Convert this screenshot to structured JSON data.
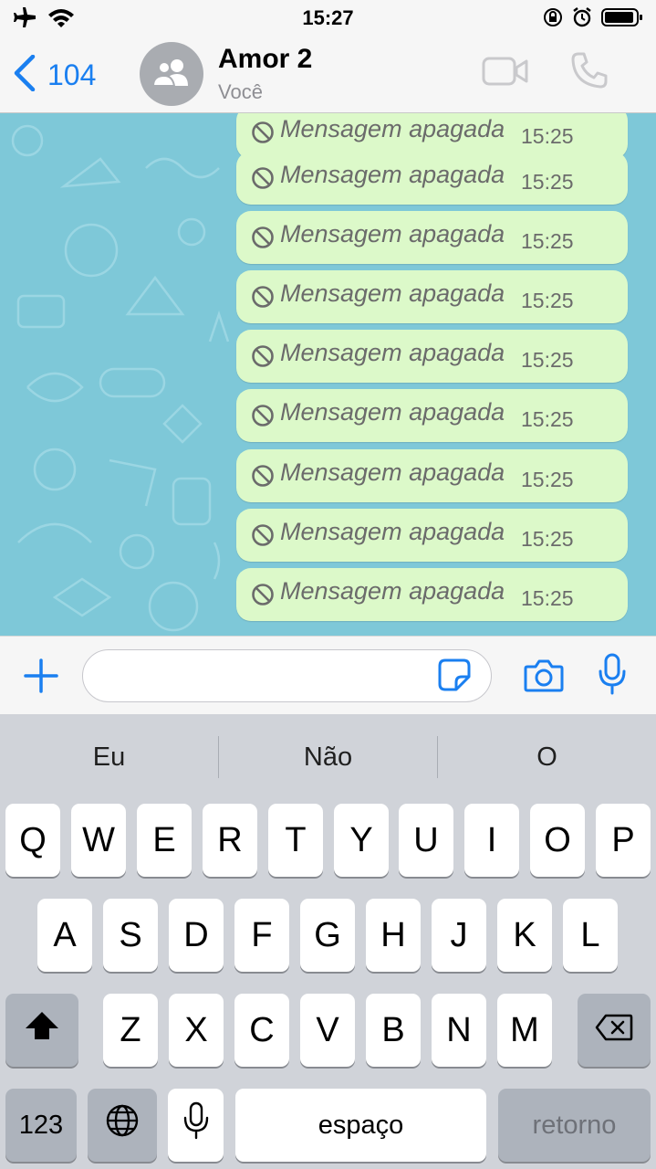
{
  "status_bar": {
    "time": "15:27",
    "left_icons": [
      "airplane-icon",
      "wifi-icon"
    ],
    "right_icons": [
      "rotation-lock-icon",
      "alarm-icon",
      "battery-icon"
    ]
  },
  "header": {
    "back_count": "104",
    "contact_name": "Amor 2",
    "contact_subtitle": "Você",
    "actions": [
      "video-call-icon",
      "phone-icon"
    ]
  },
  "messages": [
    {
      "text": "Mensagem apagada",
      "time": "15:25"
    },
    {
      "text": "Mensagem apagada",
      "time": "15:25"
    },
    {
      "text": "Mensagem apagada",
      "time": "15:25"
    },
    {
      "text": "Mensagem apagada",
      "time": "15:25"
    },
    {
      "text": "Mensagem apagada",
      "time": "15:25"
    },
    {
      "text": "Mensagem apagada",
      "time": "15:25"
    },
    {
      "text": "Mensagem apagada",
      "time": "15:25"
    },
    {
      "text": "Mensagem apagada",
      "time": "15:25"
    },
    {
      "text": "Mensagem apagada",
      "time": "15:25"
    }
  ],
  "input_bar": {
    "value": "",
    "icons": [
      "plus-icon",
      "sticker-icon",
      "camera-icon",
      "microphone-icon"
    ]
  },
  "keyboard": {
    "suggestions": [
      "Eu",
      "Não",
      "O"
    ],
    "row1": [
      "Q",
      "W",
      "E",
      "R",
      "T",
      "Y",
      "U",
      "I",
      "O",
      "P"
    ],
    "row2": [
      "A",
      "S",
      "D",
      "F",
      "G",
      "H",
      "J",
      "K",
      "L"
    ],
    "row3": [
      "Z",
      "X",
      "C",
      "V",
      "B",
      "N",
      "M"
    ],
    "numbers_label": "123",
    "space_label": "espaço",
    "return_label": "retorno"
  },
  "colors": {
    "accent": "#1a7ff0",
    "chat_background": "#7ec8d8",
    "bubble_outgoing": "#dcf9c9"
  }
}
